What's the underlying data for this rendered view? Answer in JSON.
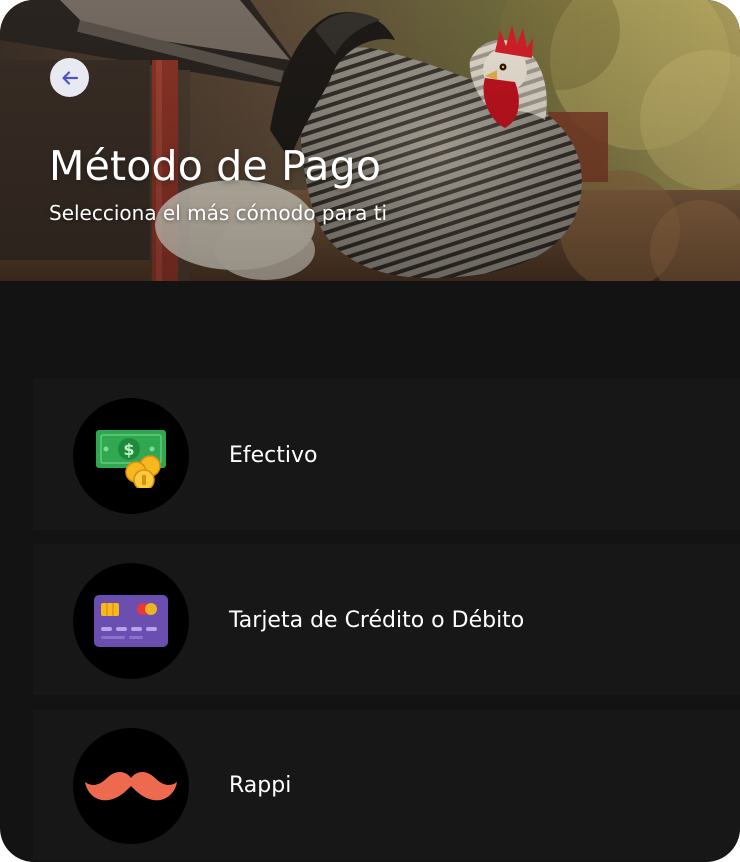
{
  "header": {
    "title": "Método de Pago",
    "subtitle": "Selecciona el más cómodo para ti",
    "back_icon": "arrow-left-icon"
  },
  "payment_methods": [
    {
      "label": "Efectivo",
      "icon": "cash-icon"
    },
    {
      "label": "Tarjeta de Crédito o Débito",
      "icon": "credit-card-icon"
    },
    {
      "label": "Rappi",
      "icon": "mustache-icon"
    }
  ],
  "colors": {
    "background": "#131313",
    "row_background": "#171717",
    "icon_circle": "#000000",
    "back_button": "#e9e9f1",
    "back_arrow": "#4b55c9",
    "cash_green": "#2fa84f",
    "coin_gold": "#f6b71f",
    "card_purple": "#6a4fb0",
    "mustache_orange": "#ee6a4f"
  }
}
